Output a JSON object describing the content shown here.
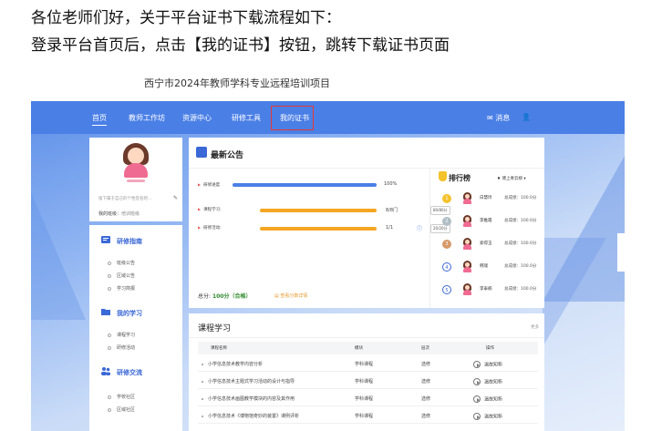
{
  "intro": {
    "line1": "各位老师们好，关于平台证书下载流程如下：",
    "line2": "登录平台首页后，点击【我的证书】按钮，跳转下载证书页面"
  },
  "site": {
    "title": "西宁市2024年教师学科专业远程培训项目"
  },
  "nav": {
    "items": [
      "首页",
      "教师工作坊",
      "资源中心",
      "研修工具",
      "我的证书"
    ],
    "messages": "消息"
  },
  "profile": {
    "name": "",
    "signature": "留下属于自己的个性签名吧...",
    "class_label": "我的班级：",
    "class_value": "培训班级"
  },
  "sidebar": {
    "sections": [
      {
        "title": "研修指南",
        "items": [
          "班级公告",
          "区域公告",
          "学习简报"
        ]
      },
      {
        "title": "我的学习",
        "items": [
          "课程学习",
          "研修活动"
        ]
      },
      {
        "title": "研修交流",
        "items": [
          "学校社区",
          "区域社区"
        ]
      }
    ]
  },
  "announcement": {
    "title": "最新公告"
  },
  "progress": {
    "items": [
      {
        "label": "研修进度",
        "value": "100%",
        "fraction": 1.0,
        "score": ""
      },
      {
        "label": "课程学习:",
        "value": "8/8门",
        "fraction": 1.0,
        "score": "80/80分"
      },
      {
        "label": "研修活动:",
        "value": "1/1",
        "fraction": 1.0,
        "score": "20/20分"
      }
    ],
    "total_label": "总分:",
    "total_value": "100分（合格）",
    "detail_link": "查看分数详情"
  },
  "ranking": {
    "title": "排行榜",
    "tab": "♦ 博上青云榜 ▾",
    "items": [
      {
        "rank": "1",
        "name": "白慧玲",
        "score": "总成绩：100.0分"
      },
      {
        "rank": "2",
        "name": "李推霞",
        "score": "总成绩：100.0分"
      },
      {
        "rank": "3",
        "name": "索得玉",
        "score": "总成绩：100.0分"
      },
      {
        "rank": "4",
        "name": "韩瑞",
        "score": "总成绩：100.0分"
      },
      {
        "rank": "5",
        "name": "李泰楠",
        "score": "总成绩：100.0分"
      }
    ],
    "medal_colors": [
      "#f4c22d",
      "#b0bec5",
      "#d69a6a",
      "#3a68d6",
      "#3a68d6"
    ]
  },
  "courses": {
    "title": "课程学习",
    "more": "更多",
    "headers": [
      "课程名称",
      "模块",
      "层次",
      "操作"
    ],
    "rows": [
      {
        "name": "小学信息技术教学内容分析",
        "module": "学科课程",
        "level": "选修",
        "action": "温故知新"
      },
      {
        "name": "小学信息技术主题式学习活动的设计与指导",
        "module": "学科课程",
        "level": "选修",
        "action": "温故知新"
      },
      {
        "name": "小学信息技术画图教学模块的内容及其作用",
        "module": "学科课程",
        "level": "选修",
        "action": "温故知新"
      },
      {
        "name": "小学信息技术《博物馆奇妙的装置》课例评析",
        "module": "学科课程",
        "level": "选修",
        "action": "温故知新"
      }
    ]
  },
  "colors": {
    "nav_blue": "#4a7fe6",
    "accent_blue": "#3a68d6",
    "highlight_red": "#e53935",
    "progress_blue": "#4a7fe6",
    "progress_orange": "#f5a623"
  }
}
